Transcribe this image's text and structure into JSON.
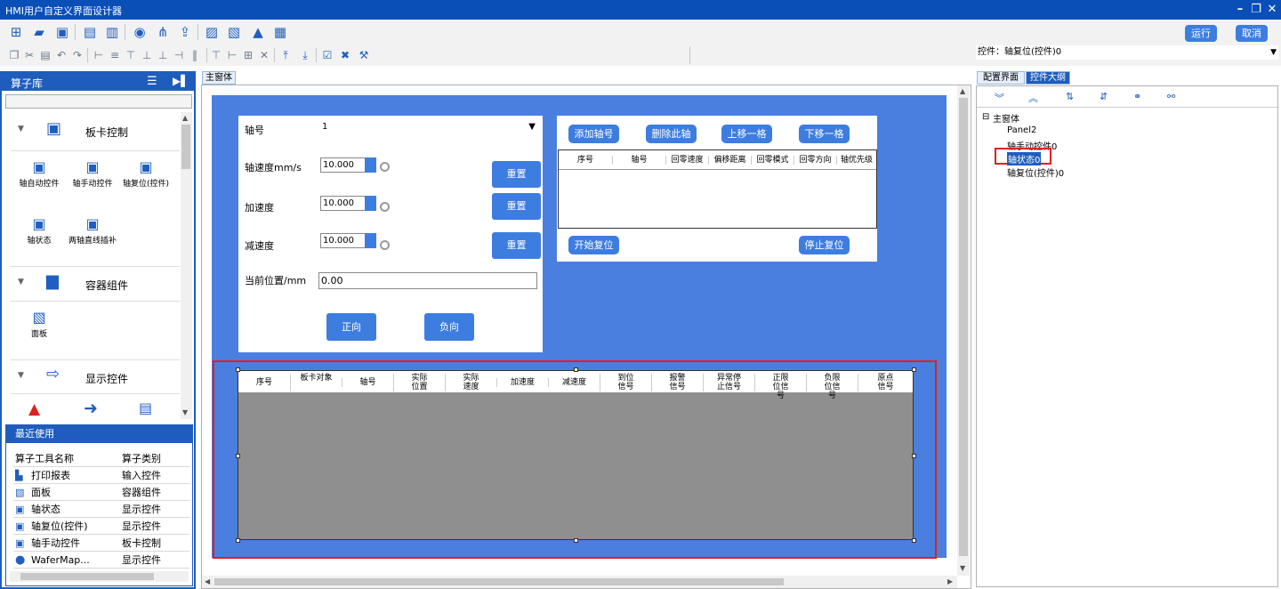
{
  "window": {
    "title": "HMI用户自定义界面设计器"
  },
  "toolbar": {
    "run_label": "运行",
    "cancel_label": "取消"
  },
  "property_bar": {
    "control_label": "控件：轴复位(控件)0"
  },
  "left_panel": {
    "title": "算子库",
    "categories": [
      {
        "label": "板卡控制",
        "tools": [
          "轴自动控件",
          "轴手动控件",
          "轴复位(控件)",
          "轴状态",
          "两轴直线插补"
        ]
      },
      {
        "label": "容器组件",
        "tools": [
          "面板"
        ]
      },
      {
        "label": "显示控件",
        "tools": []
      }
    ],
    "recent": {
      "title": "最近使用",
      "header": [
        "算子工具名称",
        "算子类别"
      ],
      "rows": [
        [
          "打印报表",
          "输入控件"
        ],
        [
          "面板",
          "容器组件"
        ],
        [
          "轴状态",
          "显示控件"
        ],
        [
          "轴复位(控件)",
          "显示控件"
        ],
        [
          "轴手动控件",
          "板卡控制"
        ],
        [
          "WaferMap...",
          "显示控件"
        ]
      ]
    }
  },
  "canvas": {
    "tab": "主窗体",
    "axis_form": {
      "axis_label": "轴号",
      "axis_value": "1",
      "speed_label": "轴速度mm/s",
      "speed_value": "10.000",
      "accel_label": "加速度",
      "accel_value": "10.000",
      "decel_label": "减速度",
      "decel_value": "10.000",
      "reset_label": "重置",
      "pos_label": "当前位置/mm",
      "pos_value": "0.00",
      "forward_label": "正向",
      "reverse_label": "负向"
    },
    "home_panel": {
      "add_axis": "添加轴号",
      "delete_axis": "删除此轴",
      "move_up": "上移一格",
      "move_down": "下移一格",
      "columns": [
        "序号",
        "轴号",
        "回零速度",
        "偏移距离",
        "回零模式",
        "回零方向",
        "轴优先级"
      ],
      "start": "开始复位",
      "stop": "停止复位"
    },
    "status_table": {
      "columns": [
        "序号",
        "板卡对象",
        "轴号",
        "实际位置",
        "实际速度",
        "加速度",
        "减速度",
        "到位信号",
        "报警信号",
        "异常停止信号",
        "正限位信号",
        "负限位信号",
        "原点信号"
      ]
    }
  },
  "right_panel": {
    "tabs": [
      "配置界面",
      "控件大纲"
    ],
    "tree": {
      "root": "主窗体",
      "children": [
        "Panel2",
        "轴手动控件0",
        "轴状态0",
        "轴复位(控件)0"
      ]
    }
  }
}
